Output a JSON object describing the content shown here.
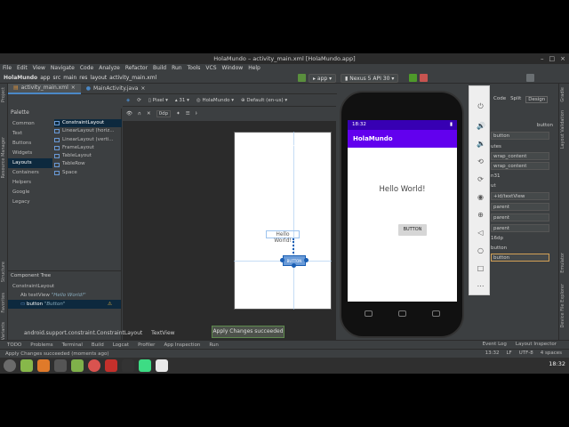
{
  "window": {
    "title": "HolaMundo – activity_main.xml [HolaMundo.app]"
  },
  "menu": [
    "File",
    "Edit",
    "View",
    "Navigate",
    "Code",
    "Analyze",
    "Refactor",
    "Build",
    "Run",
    "Tools",
    "VCS",
    "Window",
    "Help"
  ],
  "breadcrumb": [
    "HolaMundo",
    "app",
    "src",
    "main",
    "res",
    "layout",
    "activity_main.xml"
  ],
  "toolbar": {
    "run_config": "app",
    "device": "Nexus 5 API 30"
  },
  "editor_tabs": [
    {
      "label": "activity_main.xml",
      "active": true
    },
    {
      "label": "MainActivity.java",
      "active": false
    }
  ],
  "left_strip": [
    "Project",
    "Resource Manager",
    "Structure",
    "Favorites",
    "Build Variants"
  ],
  "right_strip": [
    "Gradle",
    "Layout Validation",
    "Emulator",
    "Device File Explorer"
  ],
  "palette": {
    "title": "Palette",
    "categories": [
      "Common",
      "Text",
      "Buttons",
      "Widgets",
      "Layouts",
      "Containers",
      "Helpers",
      "Google",
      "Legacy"
    ],
    "active_category": "Layouts",
    "items": [
      "ConstraintLayout",
      "LinearLayout (horiz...",
      "LinearLayout (verti...",
      "FrameLayout",
      "TableLayout",
      "TableRow",
      "Space"
    ]
  },
  "design_toolbar": {
    "pixel": "Pixel",
    "api": "31",
    "theme": "HolaMundo",
    "locale": "Default (en-us)",
    "dp": "0dp"
  },
  "component_tree": {
    "title": "Component Tree",
    "rows": [
      {
        "label": "ConstraintLayout",
        "sub": ""
      },
      {
        "label": "Ab textView",
        "sub": "\"Hello World!\""
      },
      {
        "label": "button",
        "sub": "\"Button\""
      }
    ]
  },
  "preview": {
    "text": "Hello World!",
    "button": "BUTTON"
  },
  "attributes": {
    "view_modes": [
      "Code",
      "Split",
      "Design"
    ],
    "id": "button",
    "rows": [
      "utes",
      "wrap_content",
      "wrap_content",
      "n31",
      "ut",
      "+id/textView",
      "parent",
      "parent",
      "parent",
      "16dp",
      "button",
      "button"
    ]
  },
  "emulator": {
    "time": "18:32",
    "app_title": "HolaMundo",
    "hello": "Hello World!",
    "button": "BUTTON"
  },
  "bottom": {
    "crumb": "android.support.constraint.ConstraintLayout",
    "crumb2": "TextView",
    "toast": "Apply Changes succeeded"
  },
  "tool_windows": [
    "TODO",
    "Problems",
    "Terminal",
    "Build",
    "Logcat",
    "Profiler",
    "App Inspection",
    "Run"
  ],
  "tool_windows_right": [
    "Event Log",
    "Layout Inspector"
  ],
  "status": {
    "message": "Apply Changes succeeded (moments ago)",
    "position": "13:32",
    "line_sep": "LF",
    "encoding": "UTF-8",
    "indent": "4 spaces"
  },
  "taskbar": {
    "clock": "18:32"
  },
  "colors": {
    "ide_bg": "#3c3f41",
    "accent": "#4a88c7",
    "app_purple": "#6200ee",
    "status_purple": "#3700b3"
  }
}
